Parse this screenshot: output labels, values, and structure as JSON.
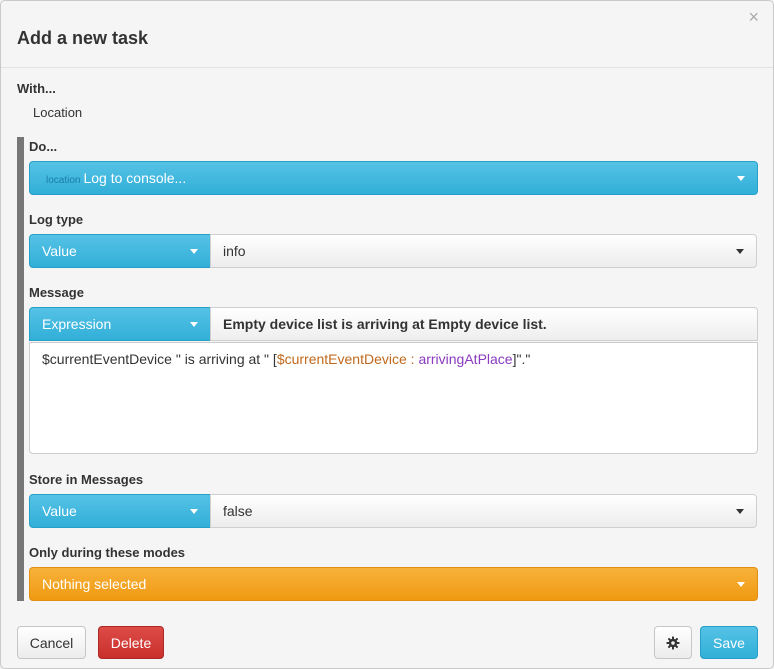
{
  "dialog": {
    "title": "Add a new task",
    "close_symbol": "×",
    "with_label": "With...",
    "with_value": "Location"
  },
  "do": {
    "label": "Do...",
    "badge": "location",
    "action": "Log to console..."
  },
  "log_type": {
    "label": "Log type",
    "mode": "Value",
    "value": "info"
  },
  "message": {
    "label": "Message",
    "mode": "Expression",
    "preview": "Empty device list is arriving at Empty device list.",
    "expression": {
      "part1": "$currentEventDevice \" is arriving at \" [",
      "var": "$currentEventDevice",
      "sep": " : ",
      "prop": "arrivingAtPlace",
      "part_end": "]\".\""
    }
  },
  "store": {
    "label": "Store in Messages",
    "mode": "Value",
    "value": "false"
  },
  "modes": {
    "label": "Only during these modes",
    "value": "Nothing selected"
  },
  "footer": {
    "cancel": "Cancel",
    "delete": "Delete",
    "save": "Save",
    "gear_icon": "gear-icon"
  },
  "colors": {
    "primary": "#31afd8",
    "danger": "#c9302c",
    "warning": "#f09a12"
  }
}
